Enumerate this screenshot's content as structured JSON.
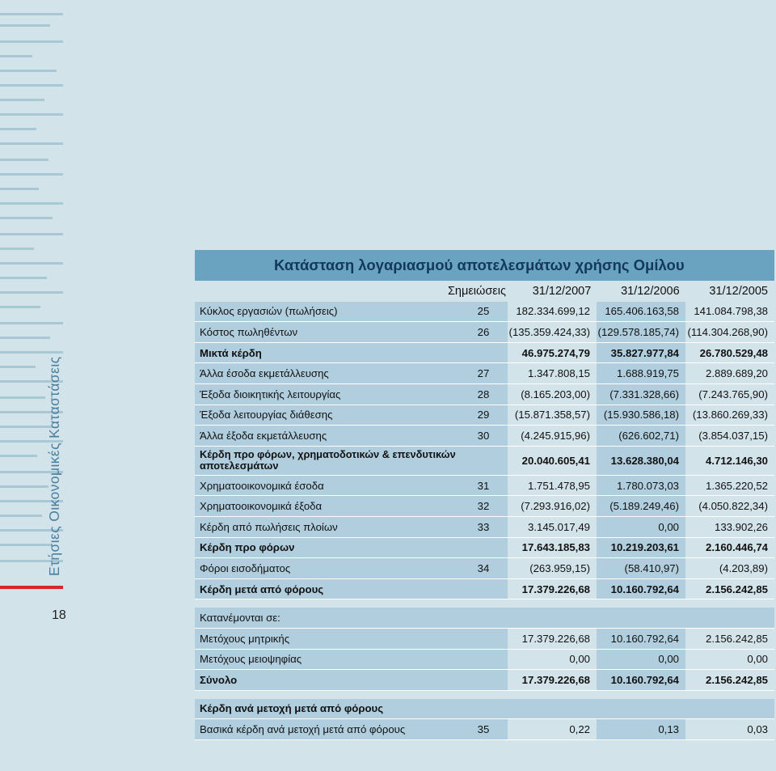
{
  "side_title": "Ετήσιες Οικονομικές Καταστάσεις",
  "page_number": "18",
  "table": {
    "title": "Κατάσταση λογαριασμού αποτελεσμάτων χρήσης Ομίλου",
    "headers": {
      "notes": "Σημειώσεις",
      "y2007": "31/12/2007",
      "y2006": "31/12/2006",
      "y2005": "31/12/2005"
    },
    "rows": [
      {
        "label": "Κύκλος εργασιών (πωλήσεις)",
        "note": "25",
        "v2007": "182.334.699,12",
        "v2006": "165.406.163,58",
        "v2005": "141.084.798,38"
      },
      {
        "label": "Κόστος πωληθέντων",
        "note": "26",
        "v2007": "(135.359.424,33)",
        "v2006": "(129.578.185,74)",
        "v2005": "(114.304.268,90)"
      },
      {
        "label": "Μικτά κέρδη",
        "note": "",
        "v2007": "46.975.274,79",
        "v2006": "35.827.977,84",
        "v2005": "26.780.529,48",
        "bold": true
      },
      {
        "label": "Άλλα έσοδα εκμετάλλευσης",
        "note": "27",
        "v2007": "1.347.808,15",
        "v2006": "1.688.919,75",
        "v2005": "2.889.689,20"
      },
      {
        "label": "Έξοδα διοικητικής λειτουργίας",
        "note": "28",
        "v2007": "(8.165.203,00)",
        "v2006": "(7.331.328,66)",
        "v2005": "(7.243.765,90)"
      },
      {
        "label": "Έξοδα λειτουργίας διάθεσης",
        "note": "29",
        "v2007": "(15.871.358,57)",
        "v2006": "(15.930.586,18)",
        "v2005": "(13.860.269,33)"
      },
      {
        "label": "Άλλα έξοδα εκμετάλλευσης",
        "note": "30",
        "v2007": "(4.245.915,96)",
        "v2006": "(626.602,71)",
        "v2005": "(3.854.037,15)"
      },
      {
        "label": "Κέρδη προ φόρων, χρηματοδοτικών & επενδυτικών αποτελεσμάτων",
        "note": "",
        "v2007": "20.040.605,41",
        "v2006": "13.628.380,04",
        "v2005": "4.712.146,30",
        "bold": true,
        "tall": true
      },
      {
        "label": "Χρηματοοικονομικά έσοδα",
        "note": "31",
        "v2007": "1.751.478,95",
        "v2006": "1.780.073,03",
        "v2005": "1.365.220,52"
      },
      {
        "label": "Χρηματοοικονομικά έξοδα",
        "note": "32",
        "v2007": "(7.293.916,02)",
        "v2006": "(5.189.249,46)",
        "v2005": "(4.050.822,34)"
      },
      {
        "label": "Κέρδη από πωλήσεις πλοίων",
        "note": "33",
        "v2007": "3.145.017,49",
        "v2006": "0,00",
        "v2005": "133.902,26"
      },
      {
        "label": "Κέρδη προ φόρων",
        "note": "",
        "v2007": "17.643.185,83",
        "v2006": "10.219.203,61",
        "v2005": "2.160.446,74",
        "bold": true
      },
      {
        "label": "Φόροι εισοδήματος",
        "note": "34",
        "v2007": "(263.959,15)",
        "v2006": "(58.410,97)",
        "v2005": "(4.203,89)"
      },
      {
        "label": "Κέρδη μετά από φόρους",
        "note": "",
        "v2007": "17.379.226,68",
        "v2006": "10.160.792,64",
        "v2005": "2.156.242,85",
        "bold": true
      }
    ],
    "allocation": {
      "title": "Κατανέμονται σε:",
      "rows": [
        {
          "label": "Μετόχους μητρικής",
          "v2007": "17.379.226,68",
          "v2006": "10.160.792,64",
          "v2005": "2.156.242,85"
        },
        {
          "label": "Μετόχους μειοψηφίας",
          "v2007": "0,00",
          "v2006": "0,00",
          "v2005": "0,00"
        },
        {
          "label": "Σύνολο",
          "v2007": "17.379.226,68",
          "v2006": "10.160.792,64",
          "v2005": "2.156.242,85",
          "bold": true
        }
      ]
    },
    "eps": {
      "title": "Κέρδη ανά μετοχή μετά από φόρους",
      "row": {
        "label": "Βασικά κέρδη ανά μετοχή μετά από φόρους",
        "note": "35",
        "v2007": "0,22",
        "v2006": "0,13",
        "v2005": "0,03"
      }
    }
  },
  "colors": {
    "background": "#d3e3ea",
    "title_bar": "#6aa3bf",
    "shaded_column": "#b0cede",
    "accent_red": "#d7262e",
    "side_text": "#4a7fa0"
  }
}
